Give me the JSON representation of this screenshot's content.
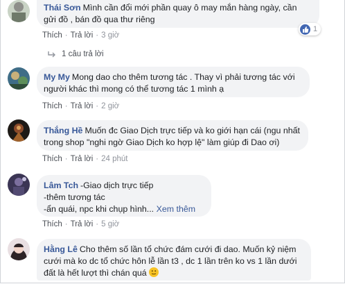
{
  "colors": {
    "name_link": "#385898",
    "bubble_bg": "#f2f3f5",
    "meta": "#90949c",
    "like_blue": "#4267b2"
  },
  "comments": [
    {
      "name": "Thái Sơn",
      "text_lines": [
        "Mình cần đổi mới phần quay ô may mắn hàng ngày, cần",
        "gửi đồ , bán đồ qua thư riêng"
      ],
      "like": "Thích",
      "reply": "Trả lời",
      "time": "3 giờ",
      "reaction_count": "1",
      "replies_label": "1 câu trả lời"
    },
    {
      "name": "My My",
      "text_lines": [
        "Mong dao cho thêm tương tác . Thay vì phải tương tác với",
        "người khác thì mong có thể tương tác 1 mình ạ"
      ],
      "like": "Thích",
      "reply": "Trả lời",
      "time": "2 giờ"
    },
    {
      "name": "Thắng Hề",
      "text_lines": [
        "Muốn đc Giao Dịch trực tiếp và ko giới hạn cái (ngu nhất",
        "trong shop \"nghi ngờ Giao Dịch ko hợp lệ\" làm giúp đi Dao ơi)"
      ],
      "like": "Thích",
      "reply": "Trả lời",
      "time": "24 phút"
    },
    {
      "name": "Lâm Tch",
      "text_lines": [
        "-Giao dịch trực tiếp",
        "-thêm tương tác",
        "-ẩn quái, npc khi chụp hình..."
      ],
      "see_more": "Xem thêm",
      "like": "Thích",
      "reply": "Trả lời",
      "time": "5 giờ"
    },
    {
      "name": "Hằng Lê",
      "text_lines": [
        "Cho thêm số lần tổ chức đám cưới đi dao. Muốn kỷ niệm",
        "cưới mà ko dc tổ chức hôn lễ lần t3 , dc 1 lần trên ko vs 1 lần dưới",
        "đất là hết lượt thì chán quá"
      ],
      "emoji": "smile-emoji"
    }
  ]
}
